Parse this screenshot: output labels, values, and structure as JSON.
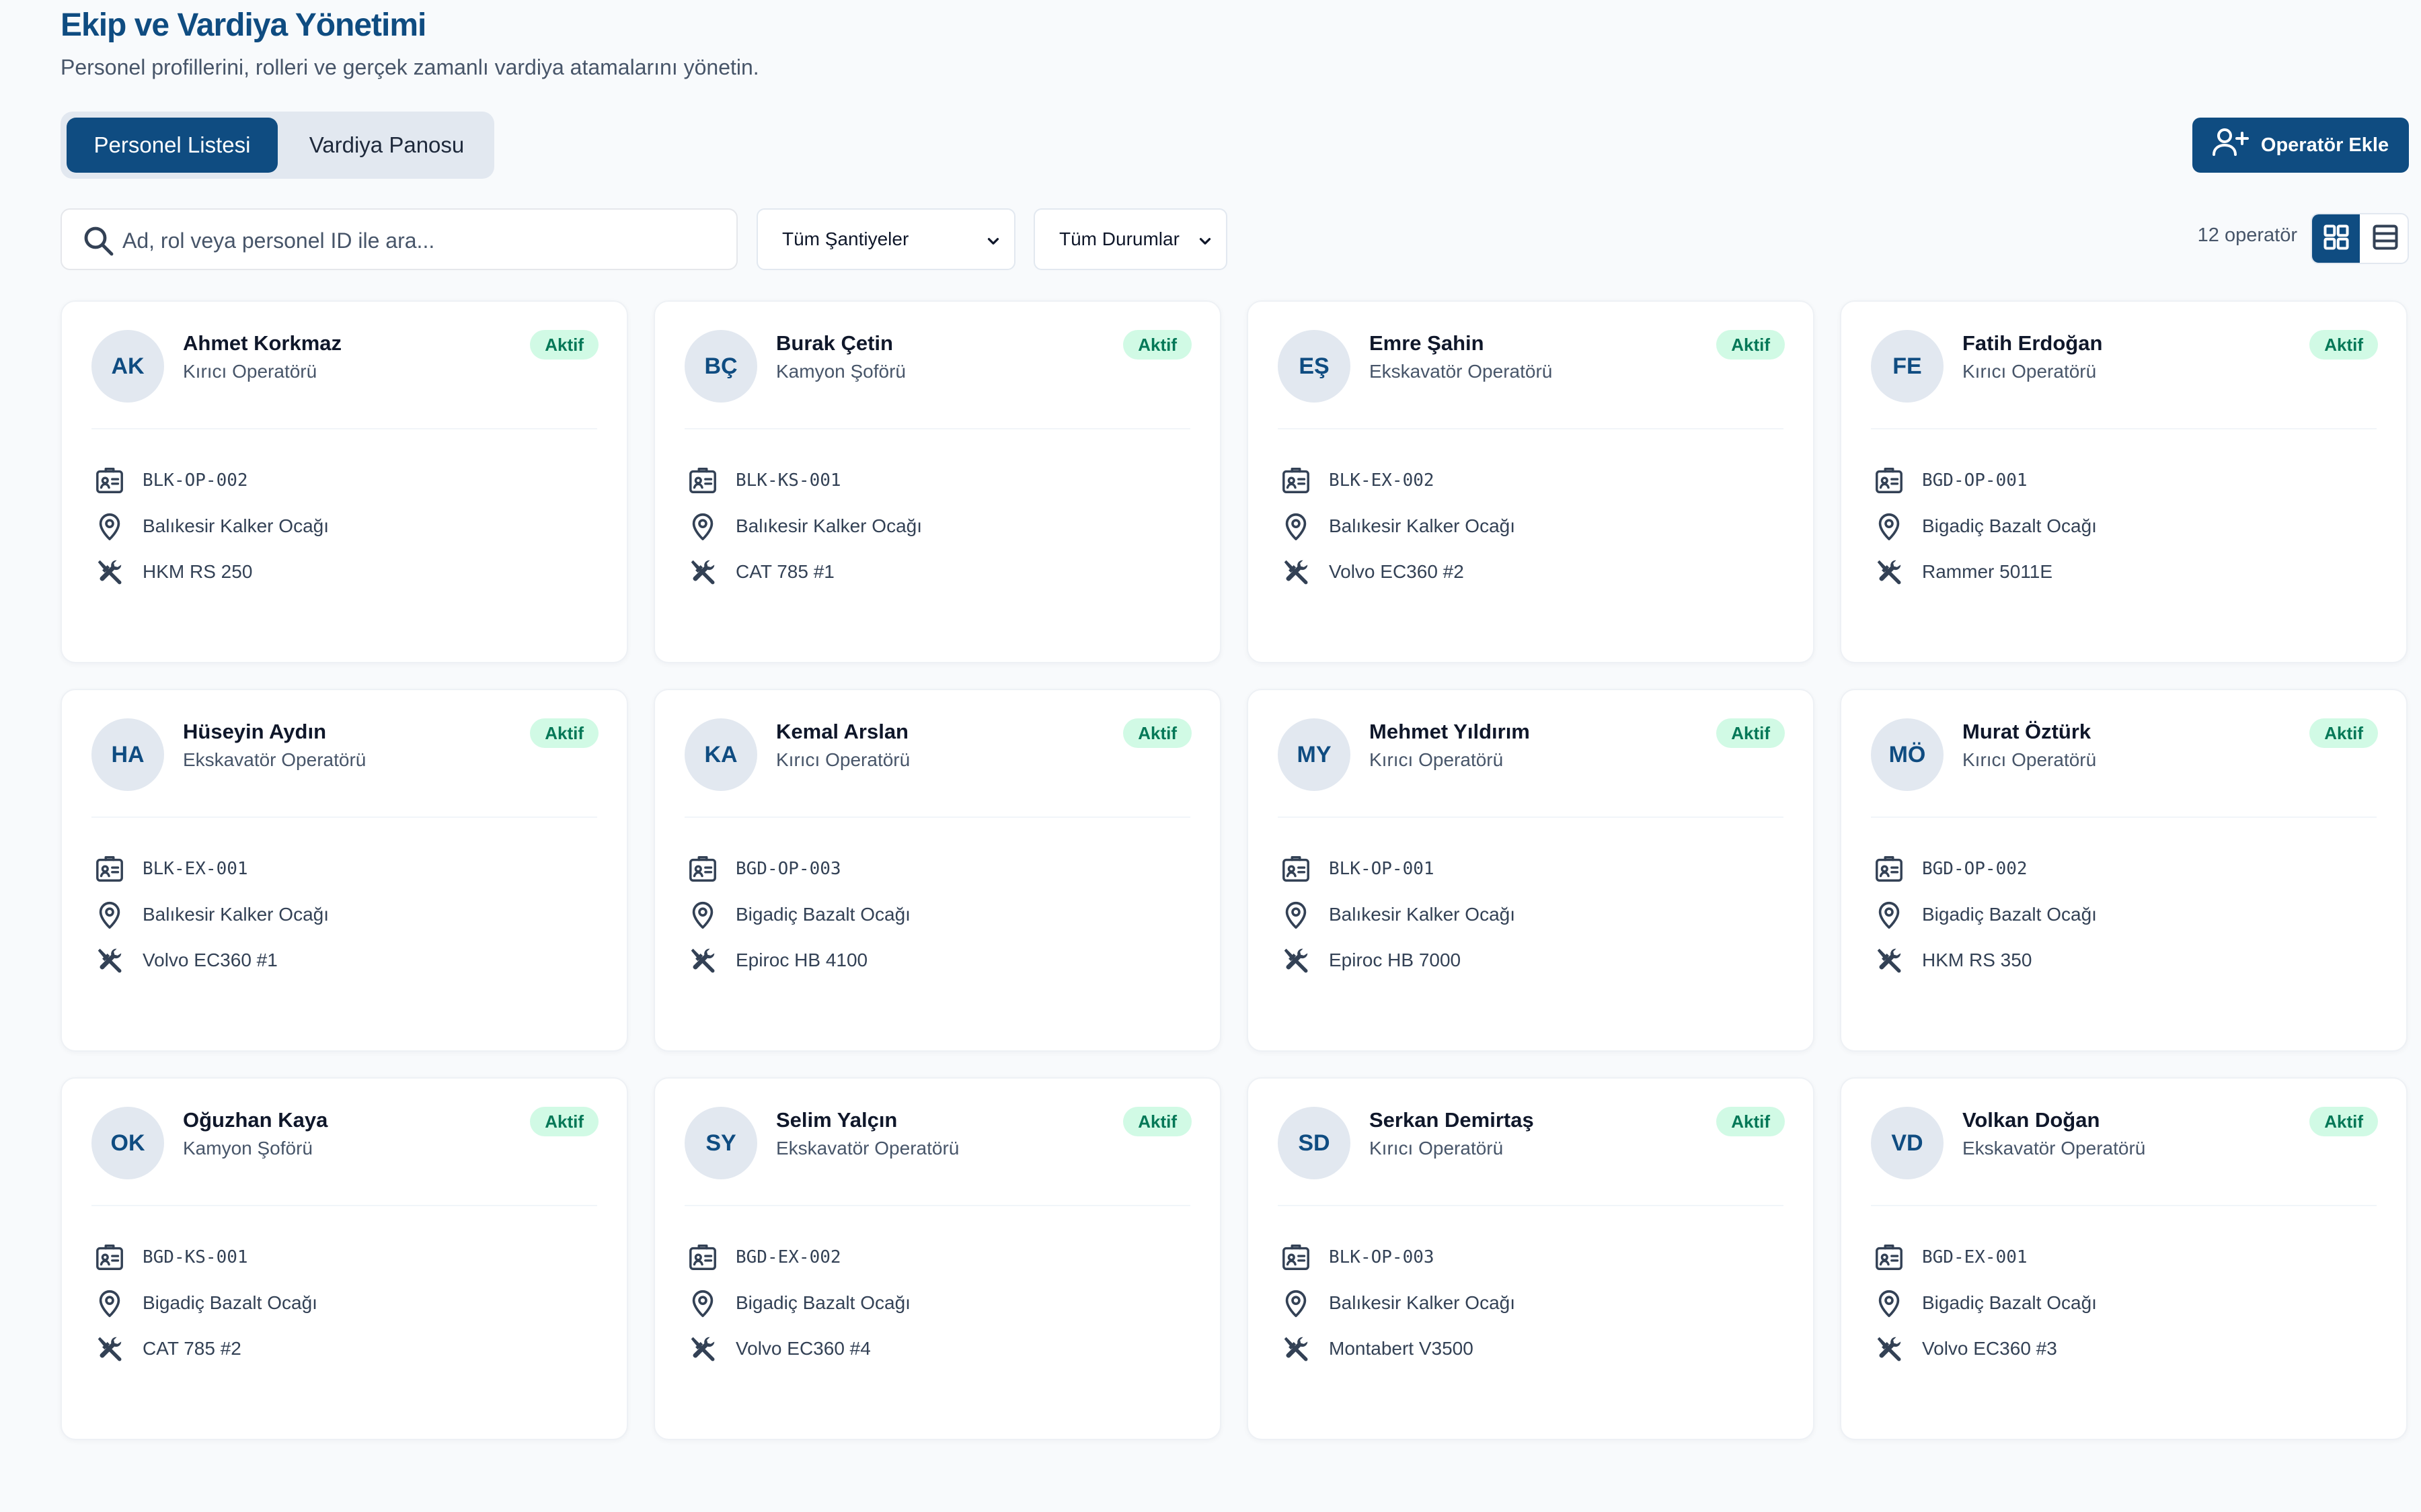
{
  "header": {
    "title": "Ekip ve Vardiya Yönetimi",
    "subtitle": "Personel profillerini, rolleri ve gerçek zamanlı vardiya atamalarını yönetin."
  },
  "tabs": [
    {
      "label": "Personel Listesi",
      "active": true
    },
    {
      "label": "Vardiya Panosu",
      "active": false
    }
  ],
  "actions": {
    "add_operator_label": "Operatör Ekle"
  },
  "filters": {
    "search_placeholder": "Ad, rol veya personel ID ile ara...",
    "site_filter": "Tüm Şantiyeler",
    "status_filter": "Tüm Durumlar",
    "count_label": "12 operatör",
    "view_mode": "grid"
  },
  "colors": {
    "primary": "#0f4c81",
    "badge_bg": "#d1fae5",
    "badge_text": "#047857",
    "avatar_bg": "#e2e8f0"
  },
  "operators": [
    {
      "initials": "AK",
      "name": "Ahmet Korkmaz",
      "role": "Kırıcı Operatörü",
      "status": "Aktif",
      "id": "BLK-OP-002",
      "site": "Balıkesir Kalker Ocağı",
      "equipment": "HKM RS 250"
    },
    {
      "initials": "BÇ",
      "name": "Burak Çetin",
      "role": "Kamyon Şoförü",
      "status": "Aktif",
      "id": "BLK-KS-001",
      "site": "Balıkesir Kalker Ocağı",
      "equipment": "CAT 785 #1"
    },
    {
      "initials": "EŞ",
      "name": "Emre Şahin",
      "role": "Ekskavatör Operatörü",
      "status": "Aktif",
      "id": "BLK-EX-002",
      "site": "Balıkesir Kalker Ocağı",
      "equipment": "Volvo EC360 #2"
    },
    {
      "initials": "FE",
      "name": "Fatih Erdoğan",
      "role": "Kırıcı Operatörü",
      "status": "Aktif",
      "id": "BGD-OP-001",
      "site": "Bigadiç Bazalt Ocağı",
      "equipment": "Rammer 5011E"
    },
    {
      "initials": "HA",
      "name": "Hüseyin Aydın",
      "role": "Ekskavatör Operatörü",
      "status": "Aktif",
      "id": "BLK-EX-001",
      "site": "Balıkesir Kalker Ocağı",
      "equipment": "Volvo EC360 #1"
    },
    {
      "initials": "KA",
      "name": "Kemal Arslan",
      "role": "Kırıcı Operatörü",
      "status": "Aktif",
      "id": "BGD-OP-003",
      "site": "Bigadiç Bazalt Ocağı",
      "equipment": "Epiroc HB 4100"
    },
    {
      "initials": "MY",
      "name": "Mehmet Yıldırım",
      "role": "Kırıcı Operatörü",
      "status": "Aktif",
      "id": "BLK-OP-001",
      "site": "Balıkesir Kalker Ocağı",
      "equipment": "Epiroc HB 7000"
    },
    {
      "initials": "MÖ",
      "name": "Murat Öztürk",
      "role": "Kırıcı Operatörü",
      "status": "Aktif",
      "id": "BGD-OP-002",
      "site": "Bigadiç Bazalt Ocağı",
      "equipment": "HKM RS 350"
    },
    {
      "initials": "OK",
      "name": "Oğuzhan Kaya",
      "role": "Kamyon Şoförü",
      "status": "Aktif",
      "id": "BGD-KS-001",
      "site": "Bigadiç Bazalt Ocağı",
      "equipment": "CAT 785 #2"
    },
    {
      "initials": "SY",
      "name": "Selim Yalçın",
      "role": "Ekskavatör Operatörü",
      "status": "Aktif",
      "id": "BGD-EX-002",
      "site": "Bigadiç Bazalt Ocağı",
      "equipment": "Volvo EC360 #4"
    },
    {
      "initials": "SD",
      "name": "Serkan Demirtaş",
      "role": "Kırıcı Operatörü",
      "status": "Aktif",
      "id": "BLK-OP-003",
      "site": "Balıkesir Kalker Ocağı",
      "equipment": "Montabert V3500"
    },
    {
      "initials": "VD",
      "name": "Volkan Doğan",
      "role": "Ekskavatör Operatörü",
      "status": "Aktif",
      "id": "BGD-EX-001",
      "site": "Bigadiç Bazalt Ocağı",
      "equipment": "Volvo EC360 #3"
    }
  ]
}
